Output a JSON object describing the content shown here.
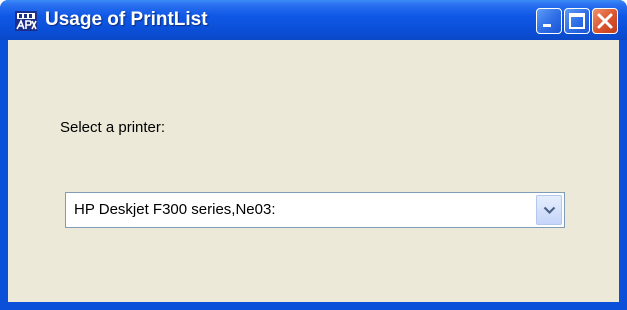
{
  "window": {
    "title": "Usage of PrintList",
    "icon": "app-icon"
  },
  "controls": {
    "minimize": "minimize-icon",
    "maximize": "maximize-icon",
    "close": "close-icon"
  },
  "form": {
    "printer_label": "Select a printer:",
    "printer_selected": "HP Deskjet F300 series,Ne03:"
  },
  "colors": {
    "titlebar": "#0b4fd8",
    "client_background": "#ece9d8",
    "close_button": "#d9542e"
  }
}
